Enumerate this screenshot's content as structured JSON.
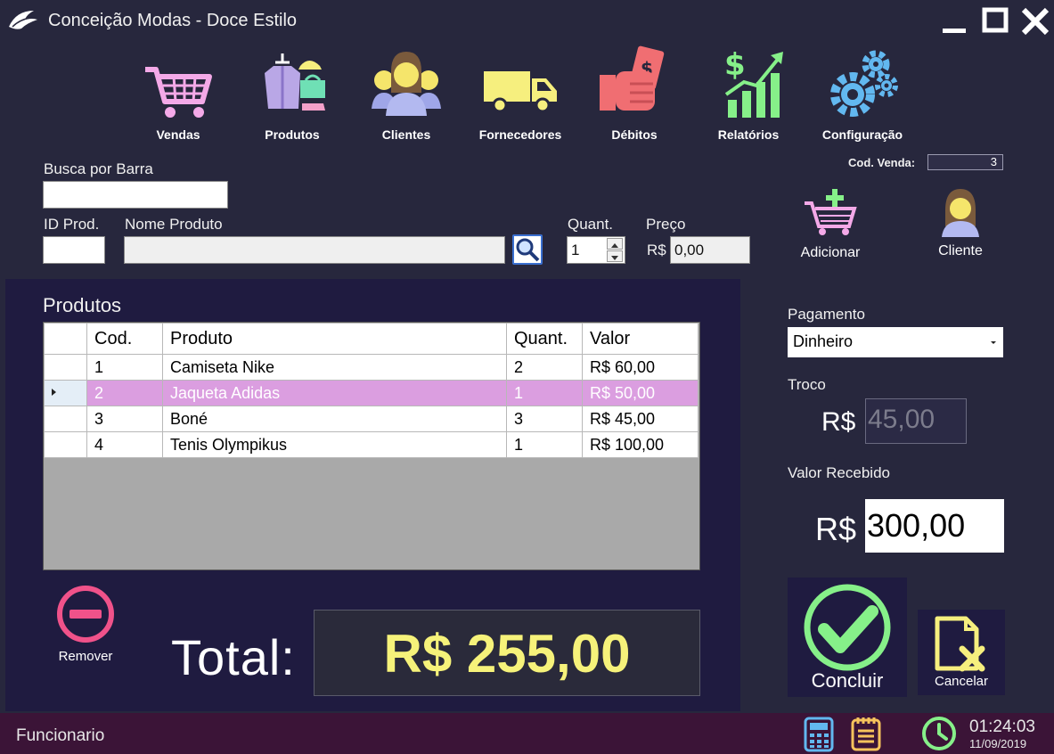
{
  "window": {
    "title": "Conceição Modas - Doce Estilo"
  },
  "toolbar": {
    "items": [
      {
        "label": "Vendas",
        "icon": "shopping-cart-icon",
        "color": "#f4a9e8"
      },
      {
        "label": "Produtos",
        "icon": "clothing-icon",
        "color": "#b9a7e6"
      },
      {
        "label": "Clientes",
        "icon": "people-icon",
        "color": "#f5e56b"
      },
      {
        "label": "Fornecedores",
        "icon": "truck-icon",
        "color": "#f6ef7e"
      },
      {
        "label": "Débitos",
        "icon": "money-hand-icon",
        "color": "#f06e72"
      },
      {
        "label": "Relatórios",
        "icon": "chart-growth-icon",
        "color": "#86f089"
      },
      {
        "label": "Configuração",
        "icon": "gears-icon",
        "color": "#62b8f0"
      }
    ]
  },
  "sale": {
    "code_label": "Cod. Venda:",
    "code_value": "3"
  },
  "form": {
    "barcode_label": "Busca por Barra",
    "barcode_value": "",
    "id_label": "ID Prod.",
    "id_value": "",
    "name_label": "Nome Produto",
    "name_value": "",
    "qty_label": "Quant.",
    "qty_value": "1",
    "price_label": "Preço",
    "price_currency": "R$",
    "price_value": "0,00"
  },
  "actions": {
    "add_label": "Adicionar",
    "client_label": "Cliente",
    "remove_label": "Remover",
    "conclude_label": "Concluir",
    "cancel_label": "Cancelar"
  },
  "products": {
    "title": "Produtos",
    "columns": [
      "Cod.",
      "Produto",
      "Quant.",
      "Valor"
    ],
    "rows": [
      {
        "cod": "1",
        "produto": "Camiseta Nike",
        "quant": "2",
        "valor": "R$ 60,00"
      },
      {
        "cod": "2",
        "produto": "Jaqueta Adidas",
        "quant": "1",
        "valor": "R$ 50,00"
      },
      {
        "cod": "3",
        "produto": "Boné",
        "quant": "3",
        "valor": "R$ 45,00"
      },
      {
        "cod": "4",
        "produto": "Tenis Olympikus",
        "quant": "1",
        "valor": "R$ 100,00"
      }
    ],
    "selected_row": 1
  },
  "totals": {
    "total_label": "Total:",
    "total_value": "R$ 255,00"
  },
  "payment": {
    "label": "Pagamento",
    "selected": "Dinheiro",
    "troco_label": "Troco",
    "troco_currency": "R$",
    "troco_value": "45,00",
    "received_label": "Valor Recebido",
    "received_currency": "R$",
    "received_value": "300,00"
  },
  "status": {
    "user": "Funcionario",
    "time": "01:24:03",
    "date": "11/09/2019"
  },
  "colors": {
    "background": "#27273d",
    "panel": "#1f1b40",
    "status_bar": "#3b1437",
    "selected_row": "#db9ee0",
    "total_text": "#f6f27a",
    "accent_pink": "#f0528a",
    "accent_green": "#86f089"
  }
}
